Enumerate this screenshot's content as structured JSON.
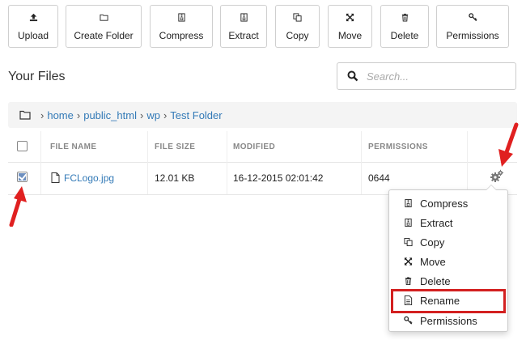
{
  "toolbar": {
    "buttons": [
      {
        "label": "Upload",
        "icon": "upload-icon"
      },
      {
        "label": "Create Folder",
        "icon": "folder-icon"
      },
      {
        "label": "Compress",
        "icon": "archive-icon"
      },
      {
        "label": "Extract",
        "icon": "archive-icon"
      },
      {
        "label": "Copy",
        "icon": "copy-icon"
      },
      {
        "label": "Move",
        "icon": "move-icon"
      },
      {
        "label": "Delete",
        "icon": "trash-icon"
      },
      {
        "label": "Permissions",
        "icon": "key-icon"
      }
    ]
  },
  "page": {
    "title": "Your Files"
  },
  "search": {
    "placeholder": "Search..."
  },
  "breadcrumb": {
    "items": [
      "home",
      "public_html",
      "wp",
      "Test Folder"
    ]
  },
  "table": {
    "headers": [
      "FILE NAME",
      "FILE SIZE",
      "MODIFIED",
      "PERMISSIONS"
    ],
    "rows": [
      {
        "name": "FCLogo.jpg",
        "size": "12.01 KB",
        "modified": "16-12-2015 02:01:42",
        "permissions": "0644",
        "checked": true
      }
    ]
  },
  "context_menu": {
    "items": [
      {
        "label": "Compress",
        "icon": "archive-icon"
      },
      {
        "label": "Extract",
        "icon": "archive-icon"
      },
      {
        "label": "Copy",
        "icon": "copy-icon"
      },
      {
        "label": "Move",
        "icon": "move-icon"
      },
      {
        "label": "Delete",
        "icon": "trash-icon"
      },
      {
        "label": "Rename",
        "icon": "file-icon",
        "highlighted": true
      },
      {
        "label": "Permissions",
        "icon": "key-icon"
      }
    ]
  },
  "colors": {
    "link": "#337ab7",
    "highlight": "#d32020",
    "annotation_arrow": "#e02020",
    "breadcrumb_bg": "#f4f4f4"
  }
}
